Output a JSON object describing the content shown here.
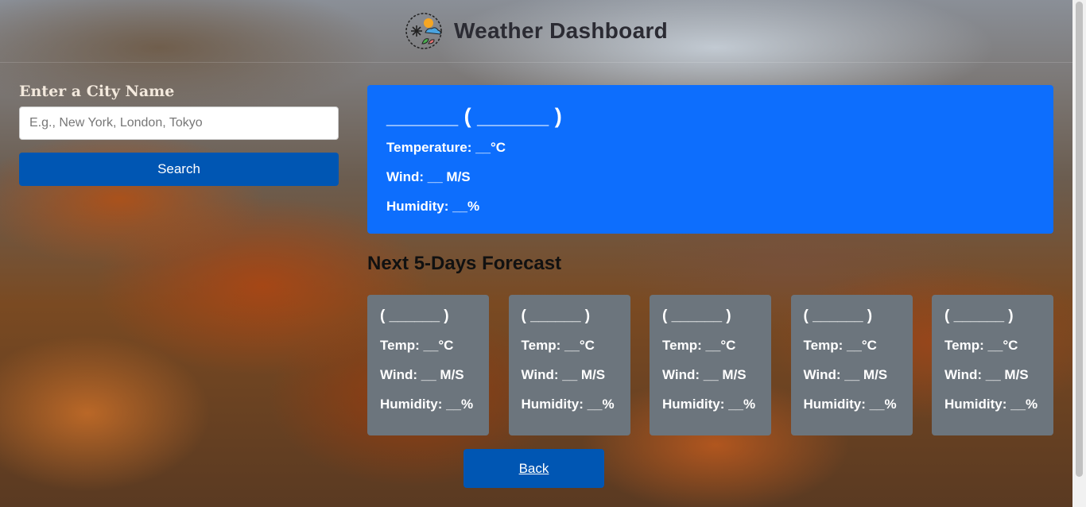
{
  "header": {
    "title": "Weather Dashboard",
    "logo_icon": "weather-logo-icon"
  },
  "sidebar": {
    "label": "Enter a City Name",
    "input_placeholder": "E.g., New York, London, Tokyo",
    "input_value": "",
    "search_label": "Search"
  },
  "current": {
    "heading": "______ ( ______ )",
    "temperature": "Temperature: __°C",
    "wind": "Wind: __ M/S",
    "humidity": "Humidity: __%",
    "color": "#0d6efd"
  },
  "forecast": {
    "title": "Next 5-Days Forecast",
    "days": [
      {
        "date": "( ______ )",
        "temp": "Temp: __°C",
        "wind": "Wind: __ M/S",
        "humidity": "Humidity: __%"
      },
      {
        "date": "( ______ )",
        "temp": "Temp: __°C",
        "wind": "Wind: __ M/S",
        "humidity": "Humidity: __%"
      },
      {
        "date": "( ______ )",
        "temp": "Temp: __°C",
        "wind": "Wind: __ M/S",
        "humidity": "Humidity: __%"
      },
      {
        "date": "( ______ )",
        "temp": "Temp: __°C",
        "wind": "Wind: __ M/S",
        "humidity": "Humidity: __%"
      },
      {
        "date": "( ______ )",
        "temp": "Temp: __°C",
        "wind": "Wind: __ M/S",
        "humidity": "Humidity: __%"
      }
    ],
    "card_color": "#6c757d"
  },
  "back_label": "Back",
  "colors": {
    "button": "#0056b3"
  }
}
